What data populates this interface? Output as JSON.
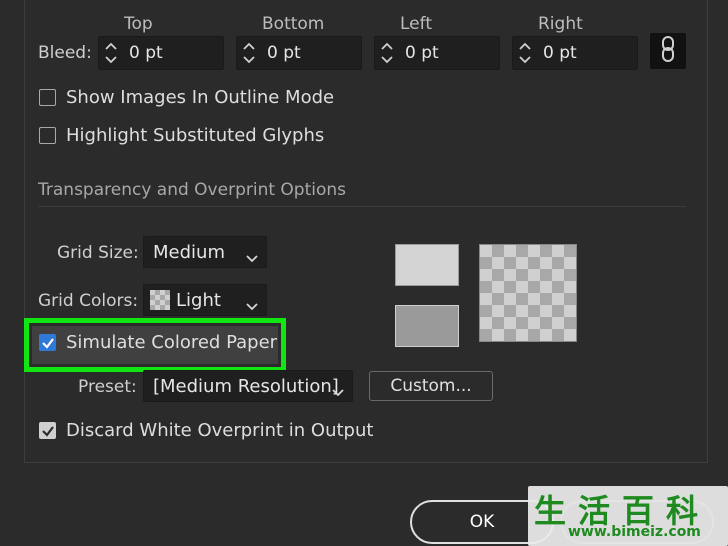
{
  "bleed": {
    "label": "Bleed:",
    "columns": [
      {
        "label": "Top",
        "value": "0 pt"
      },
      {
        "label": "Bottom",
        "value": "0 pt"
      },
      {
        "label": "Left",
        "value": "0 pt"
      },
      {
        "label": "Right",
        "value": "0 pt"
      }
    ]
  },
  "options": {
    "show_images_outline": {
      "label": "Show Images In Outline Mode",
      "checked": false
    },
    "highlight_glyphs": {
      "label": "Highlight Substituted Glyphs",
      "checked": false
    }
  },
  "transparency": {
    "section_title": "Transparency and Overprint Options",
    "grid_size": {
      "label": "Grid Size:",
      "value": "Medium"
    },
    "grid_colors": {
      "label": "Grid Colors:",
      "value": "Light"
    },
    "simulate_paper": {
      "label": "Simulate Colored Paper",
      "checked": true
    },
    "preset": {
      "label": "Preset:",
      "value": "[Medium Resolution]"
    },
    "custom_button": "Custom...",
    "discard_white": {
      "label": "Discard White Overprint in Output",
      "checked": true
    },
    "swatch_colors": {
      "top": "#d4d4d4",
      "bottom": "#9a9a9a"
    }
  },
  "footer": {
    "ok_label": "OK"
  },
  "watermark": {
    "chars": "生活百科",
    "url": "www.bimeiz.com"
  },
  "colors": {
    "highlight": "#12e612",
    "checkbox_blue": "#2f7ad8",
    "background": "#2b2b2b"
  }
}
